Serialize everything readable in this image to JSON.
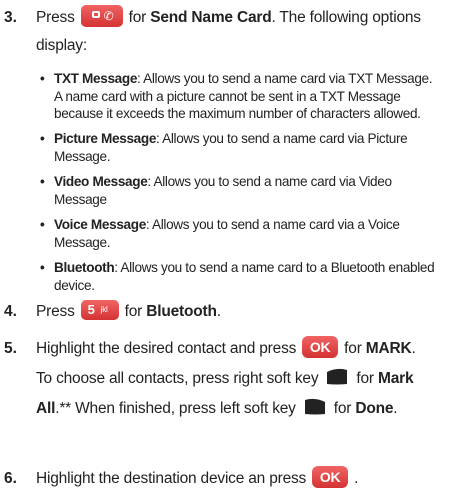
{
  "steps": [
    {
      "number": "3.",
      "line1_pre": "Press",
      "line1_mid": "for",
      "line1_bold": "Send Name Card",
      "line1_post": ". The following options",
      "line2": "display:",
      "key_icon": "send-key-icon",
      "bullets": [
        {
          "title": "TXT Message",
          "lines": [
            ": Allows you to send a name card via TXT Message.",
            "A name card with a picture cannot be sent in a TXT Message",
            "because it exceeds the maximum number of characters allowed."
          ]
        },
        {
          "title": "Picture Message",
          "lines": [
            ": Allows you to send a name card via Picture",
            "Message."
          ]
        },
        {
          "title": "Video Message",
          "lines": [
            ": Allows you to send a name card via Video",
            "Message"
          ]
        },
        {
          "title": "Voice Message",
          "lines": [
            ": Allows you to send a name card via a Voice",
            "Message."
          ]
        },
        {
          "title": "Bluetooth",
          "lines": [
            ": Allows you to send a name card to a Bluetooth enabled",
            "device."
          ]
        }
      ]
    },
    {
      "number": "4.",
      "pre": "Press",
      "mid": "for",
      "bold": "Bluetooth",
      "post": ".",
      "key_label": "5",
      "key_sub": "jkl"
    },
    {
      "number": "5.",
      "l1_pre": "Highlight the desired contact and press",
      "l1_mid": "for",
      "l1_bold": "MARK",
      "l1_post": ".",
      "l2_pre": "To choose all contacts, press right soft key",
      "l2_mid": "for",
      "l2_bold": "Mark",
      "l3_bold": "All",
      "l3_mid": ".** When finished, press left soft key",
      "l3_for": "for",
      "l3_bold2": "Done",
      "l3_post": "."
    },
    {
      "number": "6.",
      "pre": "Highlight the destination device an press",
      "post": "."
    }
  ],
  "keys": {
    "ok_label": "OK",
    "send_glyph": "✆"
  },
  "colors": {
    "key_red": "#e74c4c",
    "text": "#222222"
  }
}
